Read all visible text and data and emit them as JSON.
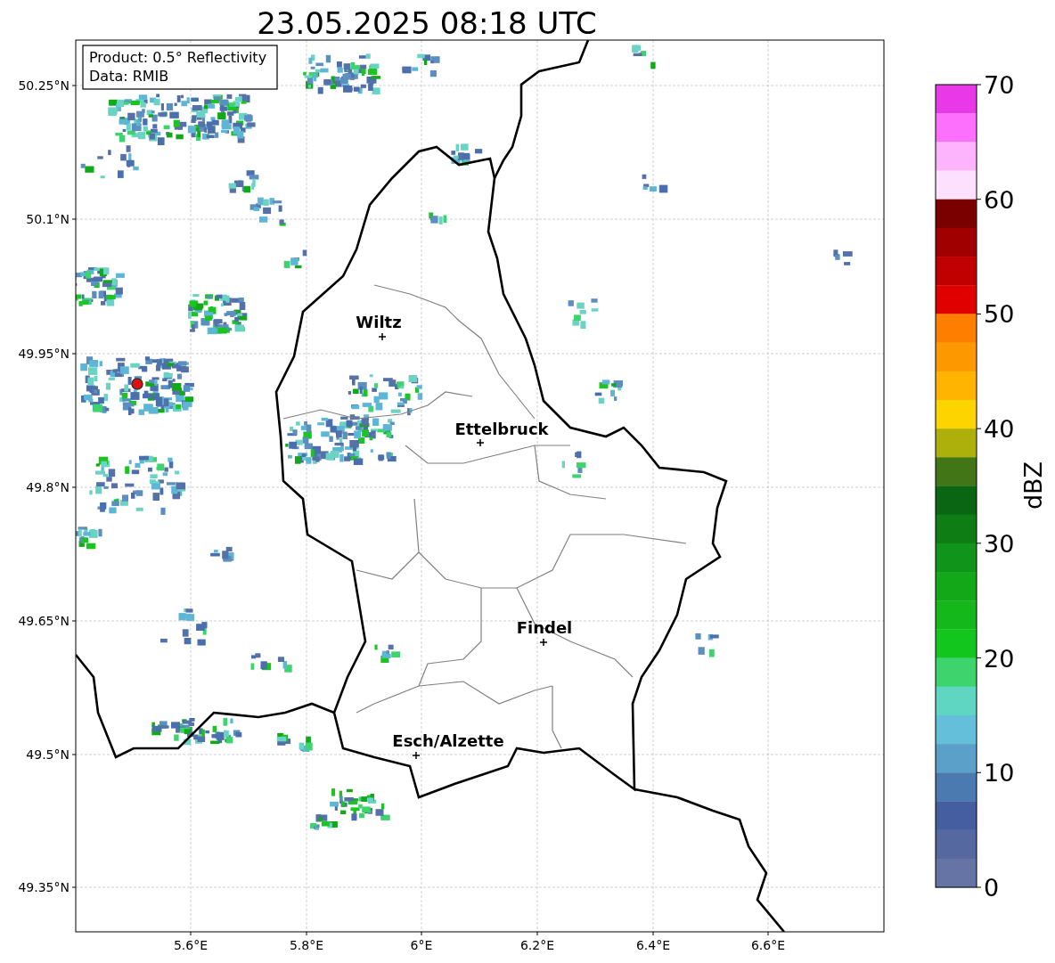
{
  "title": "23.05.2025 08:18 UTC",
  "info_box": {
    "lines": [
      "Product: 0.5° Reflectivity",
      "Data: RMIB"
    ]
  },
  "map": {
    "y_ticks": [
      "50.25°N",
      "50.1°N",
      "49.95°N",
      "49.8°N",
      "49.65°N",
      "49.5°N",
      "49.35°N"
    ],
    "x_ticks": [
      "5.6°E",
      "5.8°E",
      "6°E",
      "6.2°E",
      "6.4°E",
      "6.6°E"
    ],
    "places": [
      {
        "name": "Wiltz"
      },
      {
        "name": "Ettelbruck"
      },
      {
        "name": "Findel"
      },
      {
        "name": "Esch/Alzette"
      }
    ]
  },
  "colorbar": {
    "label": "dBZ",
    "ticks": [
      "70",
      "60",
      "50",
      "40",
      "30",
      "20",
      "10",
      "0"
    ],
    "segments": [
      {
        "color": "#e838e8"
      },
      {
        "color": "#fd70fd"
      },
      {
        "color": "#fdb4fd"
      },
      {
        "color": "#fde0fd"
      },
      {
        "color": "#7a0000"
      },
      {
        "color": "#a00000"
      },
      {
        "color": "#c00000"
      },
      {
        "color": "#e00000"
      },
      {
        "color": "#fe7e00"
      },
      {
        "color": "#fe9800"
      },
      {
        "color": "#feb400"
      },
      {
        "color": "#fed400"
      },
      {
        "color": "#adb00a"
      },
      {
        "color": "#417515"
      },
      {
        "color": "#0a6612"
      },
      {
        "color": "#0e7e14"
      },
      {
        "color": "#10951a"
      },
      {
        "color": "#12a818"
      },
      {
        "color": "#14b81a"
      },
      {
        "color": "#12c61e"
      },
      {
        "color": "#3dd46e"
      },
      {
        "color": "#5fd6c2"
      },
      {
        "color": "#64c0da"
      },
      {
        "color": "#5ba0c8"
      },
      {
        "color": "#4b7ab0"
      },
      {
        "color": "#445ea0"
      },
      {
        "color": "#55689f"
      },
      {
        "color": "#6674a5"
      }
    ]
  }
}
